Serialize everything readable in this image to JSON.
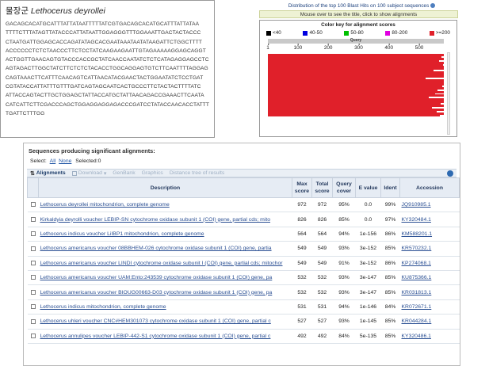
{
  "sequence_panel": {
    "title_korean": "물장군",
    "title_species": "Lethocerus deyrollei",
    "lines": [
      "GACAGCACATGCATTTATTATAATTTTTATCGTGACAGCACATGCATTTATTATAA",
      "TTTTCTTTATAGTTATACCCATTATAATTGGAGGGTTTGGAAATTGACTACTACCC",
      "CTAATGATTGGAGCACCAGATATAGCACGAATAAATAATATAAGATTCTGGCTTTT",
      "ACCCCCCTCTCTAACCCTTCTCCTATCAAGAAGAATTGTAGAAAAAGGAGCAGGT",
      "ACTGGTTGAACAGTGTACCCACCGCTATCAACCAATATCTCTCATAGAGGAGCCTC",
      "AGTAGACTTGGCTATCTTCTCTCTACACCTGGCAGGAGTGTCTTCAATTTTAGGAG",
      "CAGTAAACTTCATTTCAACAGTCATTAACATACGAACTACTGGAATATCTCCTGAT",
      "CGTATACCATTATTTGTTTGATCAGTAGCAATCACTGCCCTTCTACTACTTTTATC",
      "ATTACCAGTACTTGCTGGAGCTATTACCATGCTATTAACAGACCGAAACTTCAATA",
      "CATCATTCTTCGACCCAGCTGGAGGAGGAGACCCGATCCTATACCAACACCTATTT",
      "TGATTCTTTGG"
    ]
  },
  "graphic": {
    "title": "Distribution of the top 100 Blast Hits on 100 subject sequences",
    "mouse_note": "Mouse over to see the title, click to show alignments",
    "color_key_title": "Color key for alignment scores",
    "legend": [
      {
        "label": "<40",
        "color": "#000000"
      },
      {
        "label": "40-50",
        "color": "#0000e0"
      },
      {
        "label": "50-80",
        "color": "#00c000"
      },
      {
        "label": "80-200",
        "color": "#e000e0"
      },
      {
        "label": ">=200",
        "color": "#e0202a"
      }
    ],
    "query_label": "Query",
    "query_length": 580,
    "axis_ticks": [
      1,
      100,
      200,
      300,
      400,
      500
    ],
    "hit_bar_color": "#e0202a",
    "hits": [
      [
        1,
        580
      ],
      [
        1,
        573
      ],
      [
        1,
        580
      ],
      [
        1,
        565
      ],
      [
        1,
        580
      ],
      [
        1,
        578
      ],
      [
        1,
        580
      ],
      [
        1,
        580
      ],
      [
        1,
        545
      ],
      [
        1,
        580
      ],
      [
        1,
        580
      ],
      [
        1,
        580
      ],
      [
        1,
        520
      ],
      [
        1,
        580
      ],
      [
        1,
        580
      ],
      [
        1,
        580
      ],
      [
        1,
        575
      ],
      [
        1,
        580
      ],
      [
        1,
        560
      ],
      [
        1,
        580
      ],
      [
        1,
        550
      ],
      [
        1,
        580
      ],
      [
        1,
        530
      ],
      [
        1,
        580
      ],
      [
        1,
        580
      ],
      [
        1,
        570
      ],
      [
        1,
        580
      ],
      [
        1,
        540
      ],
      [
        1,
        580
      ],
      [
        1,
        556
      ],
      [
        1,
        580
      ],
      [
        1,
        568
      ]
    ]
  },
  "results": {
    "header": "Sequences producing significant alignments:",
    "select_label": "Select:",
    "select_all": "All",
    "select_none": "None",
    "selected_text": "Selected:0",
    "toolbar": {
      "alignments": "Alignments",
      "download": "Download",
      "genbank": "GenBank",
      "graphics": "Graphics",
      "distance_tree": "Distance tree of results"
    },
    "columns": {
      "description": "Description",
      "max_score": "Max score",
      "total_score": "Total score",
      "query_cover": "Query cover",
      "e_value": "E value",
      "ident": "Ident",
      "accession": "Accession"
    },
    "rows": [
      {
        "description": "Lethocerus deyrollei mitochondrion, complete genome",
        "max": "972",
        "total": "972",
        "cover": "95%",
        "evalue": "0.0",
        "ident": "99%",
        "accession": "JQ910985.1"
      },
      {
        "description": "Kirkaldyia deyrolli voucher LEBIP-SN cytochrome oxidase subunit 1 (COI) gene, partial cds; mito",
        "max": "826",
        "total": "826",
        "cover": "85%",
        "evalue": "0.0",
        "ident": "97%",
        "accession": "KY320484.1"
      },
      {
        "description": "Lethocerus indicus voucher LiIBP1 mitochondrion, complete genome",
        "max": "564",
        "total": "564",
        "cover": "94%",
        "evalue": "1e-156",
        "ident": "86%",
        "accession": "KM588201.1"
      },
      {
        "description": "Lethocerus americanus voucher 08BBHEM-026 cytochrome oxidase subunit 1 (COI) gene, partia",
        "max": "549",
        "total": "549",
        "cover": "93%",
        "evalue": "3e-152",
        "ident": "85%",
        "accession": "KR570232.1"
      },
      {
        "description": "Lethocerus americanus voucher LINDI cytochrome oxidase subunit I (COI) gene, partial cds; mitochor",
        "max": "549",
        "total": "549",
        "cover": "91%",
        "evalue": "3e-152",
        "ident": "86%",
        "accession": "KP274068.1"
      },
      {
        "description": "Lethocerus americanus voucher UAM:Ento:243539 cytochrome oxidase subunit 1 (COI) gene, pa",
        "max": "532",
        "total": "532",
        "cover": "93%",
        "evalue": "3e-147",
        "ident": "85%",
        "accession": "KU875366.1"
      },
      {
        "description": "Lethocerus americanus voucher BIOUG00663-D03 cytochrome oxidase subunit 1 (COI) gene, pa",
        "max": "532",
        "total": "532",
        "cover": "93%",
        "evalue": "3e-147",
        "ident": "85%",
        "accession": "KR031813.1"
      },
      {
        "description": "Lethocerus indicus mitochondrion, complete genome",
        "max": "531",
        "total": "531",
        "cover": "94%",
        "evalue": "1e-146",
        "ident": "84%",
        "accession": "KR072671.1"
      },
      {
        "description": "Lethocerus uhleri voucher CNC#HEM301073 cytochrome oxidase subunit 1 (COI) gene, partial c",
        "max": "527",
        "total": "527",
        "cover": "93%",
        "evalue": "1e-145",
        "ident": "85%",
        "accession": "KR044284.1"
      },
      {
        "description": "Lethocerus annulipes voucher LEBIP-442-S1 cytochrome oxidase subunit 1 (COI) gene, partial c",
        "max": "492",
        "total": "492",
        "cover": "84%",
        "evalue": "5e-135",
        "ident": "85%",
        "accession": "KY320486.1"
      }
    ]
  }
}
